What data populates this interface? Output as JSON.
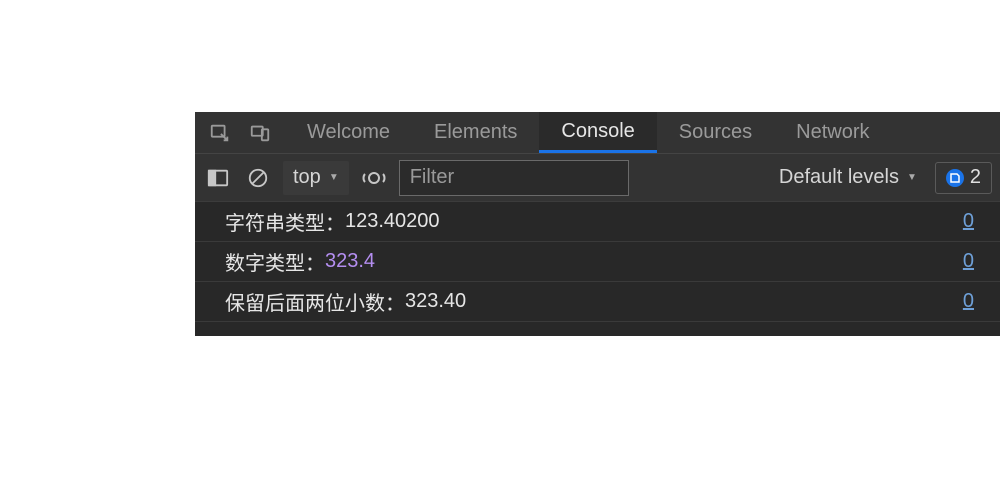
{
  "tabs": {
    "welcome": "Welcome",
    "elements": "Elements",
    "console": "Console",
    "sources": "Sources",
    "network": "Network"
  },
  "toolbar": {
    "context": "top",
    "filter_placeholder": "Filter",
    "levels_label": "Default levels",
    "issues_count": "2"
  },
  "logs": [
    {
      "label": "字符串类型：",
      "value": "123.40200",
      "type": "string",
      "src": "0"
    },
    {
      "label": "数字类型：",
      "value": "323.4",
      "type": "number",
      "src": "0"
    },
    {
      "label": "保留后面两位小数：",
      "value": "323.40",
      "type": "string",
      "src": "0"
    }
  ]
}
